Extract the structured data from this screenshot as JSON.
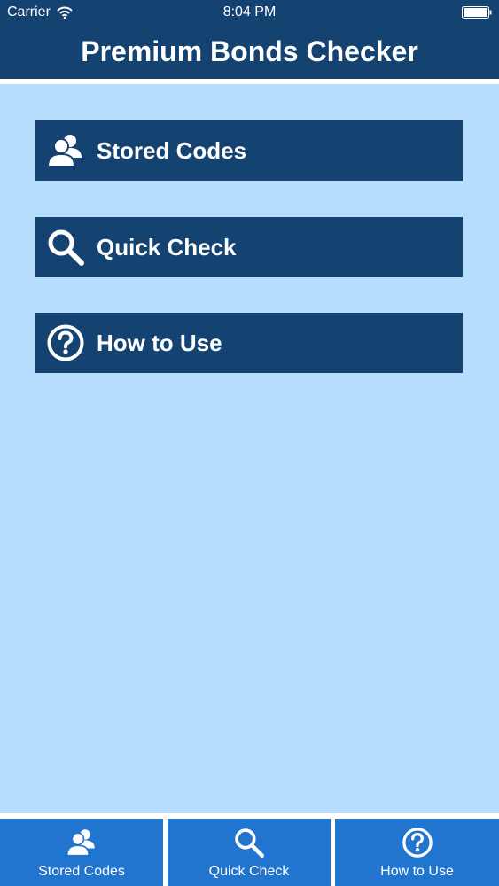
{
  "status_bar": {
    "carrier": "Carrier",
    "time": "8:04 PM"
  },
  "nav": {
    "title": "Premium Bonds Checker"
  },
  "menu": {
    "items": [
      {
        "label": "Stored Codes",
        "icon": "users-icon"
      },
      {
        "label": "Quick Check",
        "icon": "search-icon"
      },
      {
        "label": "How to Use",
        "icon": "help-icon"
      }
    ]
  },
  "tab_bar": {
    "items": [
      {
        "label": "Stored Codes",
        "icon": "users-icon"
      },
      {
        "label": "Quick Check",
        "icon": "search-icon"
      },
      {
        "label": "How to Use",
        "icon": "help-icon"
      }
    ]
  },
  "colors": {
    "navy": "#144372",
    "background": "#b6dcfe",
    "tab_blue": "#2175cf",
    "white": "#ffffff"
  }
}
